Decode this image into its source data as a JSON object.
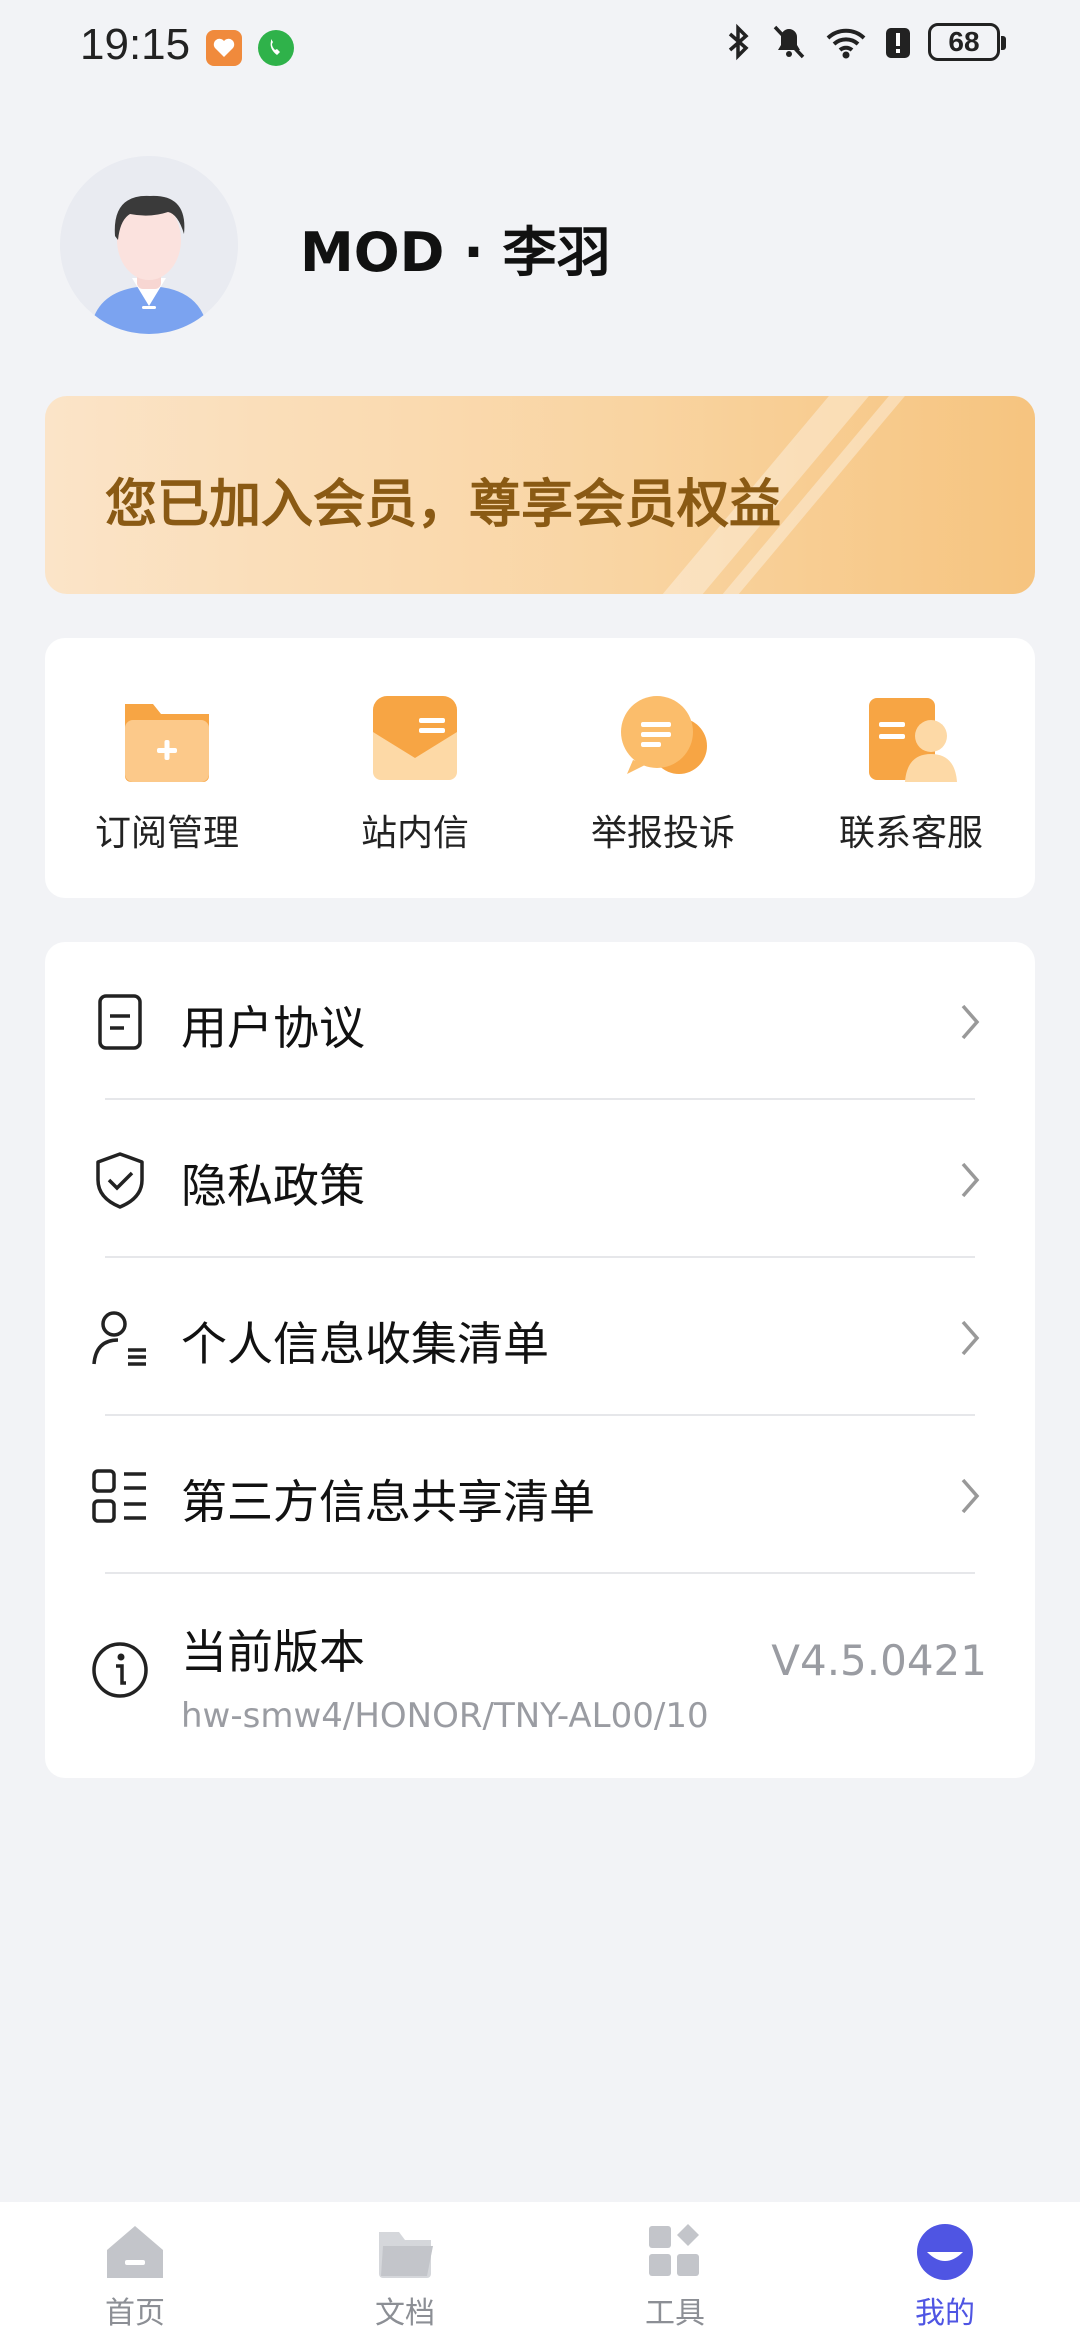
{
  "status_bar": {
    "time": "19:15",
    "battery": "68",
    "icons": [
      "bluetooth-icon",
      "mute-icon",
      "wifi-icon",
      "alert-icon",
      "battery-icon"
    ]
  },
  "profile": {
    "username": "MOD · 李羽"
  },
  "membership": {
    "text": "您已加入会员，尊享会员权益"
  },
  "quick_actions": [
    {
      "label": "订阅管理",
      "icon": "folder-add-icon"
    },
    {
      "label": "站内信",
      "icon": "mail-icon"
    },
    {
      "label": "举报投诉",
      "icon": "chat-bubble-icon"
    },
    {
      "label": "联系客服",
      "icon": "customer-service-icon"
    }
  ],
  "menu": {
    "items": [
      {
        "label": "用户协议",
        "icon": "document-icon"
      },
      {
        "label": "隐私政策",
        "icon": "shield-check-icon"
      },
      {
        "label": "个人信息收集清单",
        "icon": "user-list-icon"
      },
      {
        "label": "第三方信息共享清单",
        "icon": "grid-list-icon"
      }
    ],
    "version": {
      "label": "当前版本",
      "subtitle": "hw-smw4/HONOR/TNY-AL00/10",
      "value": "V4.5.0421",
      "icon": "info-icon"
    }
  },
  "bottom_nav": {
    "items": [
      {
        "label": "首页",
        "icon": "home-icon"
      },
      {
        "label": "文档",
        "icon": "folder-icon"
      },
      {
        "label": "工具",
        "icon": "tools-grid-icon"
      },
      {
        "label": "我的",
        "icon": "profile-face-icon"
      }
    ],
    "active_index": 3,
    "active_color": "#4f55e3",
    "inactive_color": "#c3c5ca"
  },
  "colors": {
    "background": "#f2f3f6",
    "accent_orange": "#f6a93a",
    "member_text": "#8a5a14"
  }
}
